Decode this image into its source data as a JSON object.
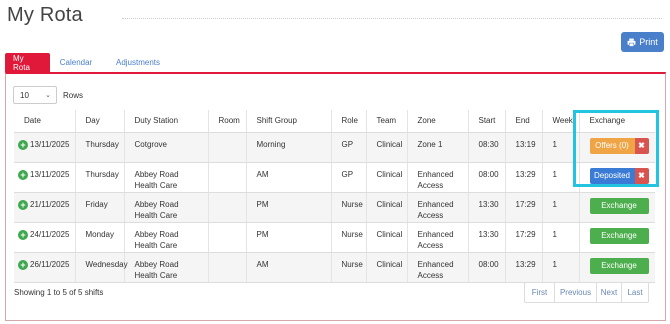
{
  "page": {
    "title": "My Rota"
  },
  "toolbar": {
    "print_label": "Print"
  },
  "tabs": [
    {
      "label": "My Rota",
      "active": true
    },
    {
      "label": "Calendar",
      "active": false
    },
    {
      "label": "Adjustments",
      "active": false
    }
  ],
  "rows_control": {
    "value": "10",
    "label": "Rows"
  },
  "table": {
    "headers": [
      "Date",
      "Day",
      "Duty Station",
      "Room",
      "Shift Group",
      "Role",
      "Team",
      "Zone",
      "Start",
      "End",
      "Week",
      "Exchange"
    ],
    "rows": [
      {
        "date": "13/11/2025",
        "day": "Thursday",
        "station": "Cotgrove",
        "room": "",
        "shift": "Morning",
        "role": "GP",
        "team": "Clinical",
        "zone": "Zone 1",
        "start": "08:30",
        "end": "13:19",
        "week": "1",
        "exchange": {
          "type": "offers",
          "label": "Offers (0)",
          "cancel": "✖"
        }
      },
      {
        "date": "13/11/2025",
        "day": "Thursday",
        "station": "Abbey Road Health Care",
        "room": "",
        "shift": "AM",
        "role": "GP",
        "team": "Clinical",
        "zone": "Enhanced Access",
        "start": "08:00",
        "end": "13:29",
        "week": "1",
        "exchange": {
          "type": "deposited",
          "label": "Deposited",
          "cancel": "✖"
        }
      },
      {
        "date": "21/11/2025",
        "day": "Friday",
        "station": "Abbey Road Health Care",
        "room": "",
        "shift": "PM",
        "role": "Nurse",
        "team": "Clinical",
        "zone": "Enhanced Access",
        "start": "13:30",
        "end": "17:29",
        "week": "1",
        "exchange": {
          "type": "exchange",
          "label": "Exchange"
        }
      },
      {
        "date": "24/11/2025",
        "day": "Monday",
        "station": "Abbey Road Health Care",
        "room": "",
        "shift": "PM",
        "role": "Nurse",
        "team": "Clinical",
        "zone": "Enhanced Access",
        "start": "13:30",
        "end": "17:29",
        "week": "1",
        "exchange": {
          "type": "exchange",
          "label": "Exchange"
        }
      },
      {
        "date": "26/11/2025",
        "day": "Wednesday",
        "station": "Abbey Road Health Care",
        "room": "",
        "shift": "AM",
        "role": "Nurse",
        "team": "Clinical",
        "zone": "Enhanced Access",
        "start": "08:00",
        "end": "13:29",
        "week": "1",
        "exchange": {
          "type": "exchange",
          "label": "Exchange"
        }
      }
    ]
  },
  "footer": {
    "info": "Showing 1 to 5 of 5 shifts",
    "pager": [
      "First",
      "Previous",
      "Next",
      "Last"
    ]
  },
  "colors": {
    "accent": "#e0193a",
    "primary": "#4a7fc9",
    "success": "#4cae4c",
    "warning": "#efa445",
    "danger": "#d9534f",
    "highlight": "#22c4e0"
  },
  "icons": {
    "print": "printer-icon",
    "add_row": "plus-circle-icon",
    "select": "chevron-down-icon"
  }
}
